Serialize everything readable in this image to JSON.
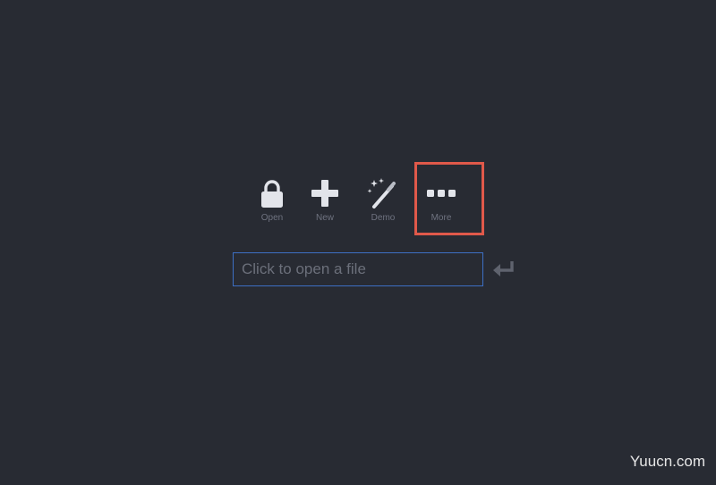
{
  "toolbar": {
    "items": [
      {
        "label": "Open",
        "icon": "lock-icon"
      },
      {
        "label": "New",
        "icon": "plus-icon"
      },
      {
        "label": "Demo",
        "icon": "magic-wand-icon"
      },
      {
        "label": "More",
        "icon": "ellipsis-icon"
      }
    ]
  },
  "search": {
    "placeholder": "Click to open a file"
  },
  "watermark": {
    "text": "Yuucn.com"
  },
  "colors": {
    "background": "#282b33",
    "icon": "#e2e4ea",
    "label": "#6f7380",
    "input_border": "#3d6fc4",
    "highlight": "#e0594a"
  }
}
